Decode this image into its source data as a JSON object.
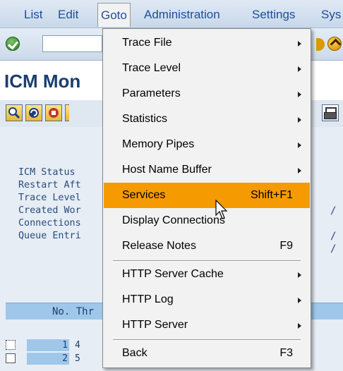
{
  "menubar": {
    "items": [
      "List",
      "Edit",
      "Goto",
      "Administration",
      "Settings",
      "Sys"
    ]
  },
  "toolbar": {
    "command_field_value": ""
  },
  "page": {
    "title": "ICM Mon"
  },
  "status_lines": [
    "ICM Status",
    "Restart Aft",
    "Trace Level",
    "Created Wor",
    "Connections",
    "Queue Entri"
  ],
  "table": {
    "header": "No. Thr",
    "rows": [
      {
        "no": "1",
        "thread": "4"
      },
      {
        "no": "2",
        "thread": "5"
      }
    ]
  },
  "goto_menu": {
    "items": [
      {
        "label": "Trace File",
        "submenu": true
      },
      {
        "label": "Trace Level",
        "submenu": true
      },
      {
        "label": "Parameters",
        "submenu": true
      },
      {
        "label": "Statistics",
        "submenu": true
      },
      {
        "label": "Memory Pipes",
        "submenu": true
      },
      {
        "label": "Host Name Buffer",
        "submenu": true
      },
      {
        "label": "Services",
        "shortcut": "Shift+F1",
        "highlighted": true
      },
      {
        "label": "Display Connections"
      },
      {
        "label": "Release Notes",
        "shortcut": "F9"
      },
      {
        "label": "HTTP Server Cache",
        "submenu": true
      },
      {
        "label": "HTTP Log",
        "submenu": true
      },
      {
        "label": "HTTP Server",
        "submenu": true
      },
      {
        "label": "Back",
        "shortcut": "F3"
      }
    ]
  },
  "colors": {
    "highlight": "#f59a00",
    "menubar_text": "#1d4d9b",
    "title_text": "#1c3e6e"
  }
}
